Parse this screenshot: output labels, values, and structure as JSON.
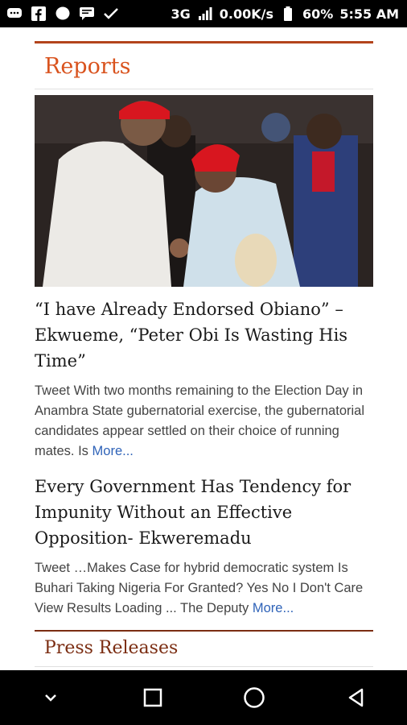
{
  "status_bar": {
    "network": "3G",
    "speed": "0.00K/s",
    "battery": "60%",
    "time": "5:55 AM",
    "icons": [
      "chat-bubble-icon",
      "facebook-icon",
      "messenger-icon",
      "sms-icon",
      "notification-check-icon",
      "signal-icon",
      "battery-icon"
    ]
  },
  "section": {
    "title": "Reports",
    "accent_color": "#d9531e"
  },
  "articles": [
    {
      "headline": "“I have Already Endorsed Obiano” – Ekwueme, “Peter Obi Is Wasting His Time”",
      "excerpt": "Tweet With two months remaining to the Election Day in Anambra State gubernatorial exercise, the gubernatorial candidates appear settled on their choice of running mates. Is ",
      "more": "More..."
    },
    {
      "headline": "Every Government Has Tendency for Impunity Without an Effective Opposition- Ekweremadu",
      "excerpt": "Tweet …Makes Case for hybrid democratic system Is Buhari Taking Nigeria For Granted? Yes No I Don't Care View Results  Loading ... The Deputy ",
      "more": "More..."
    }
  ],
  "next_section": {
    "title": "Press Releases"
  },
  "nav_bar": {
    "buttons": [
      "chevron-down-icon",
      "recents-square-icon",
      "home-circle-icon",
      "back-triangle-icon"
    ]
  }
}
